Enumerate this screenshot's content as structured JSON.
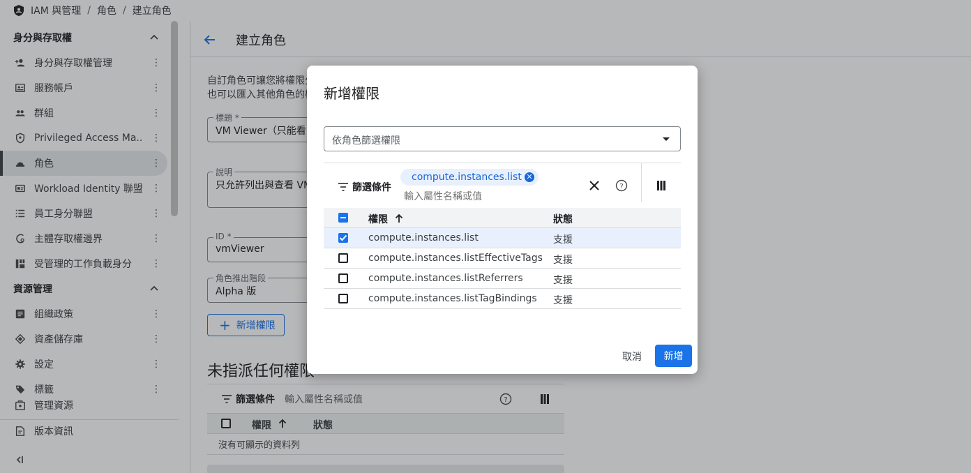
{
  "breadcrumb": [
    "IAM 與管理",
    "角色",
    "建立角色"
  ],
  "sidebar": {
    "sections": [
      {
        "label": "身分與存取權",
        "items": [
          {
            "label": "身分與存取權管理",
            "icon": "person-add-icon"
          },
          {
            "label": "服務帳戶",
            "icon": "service-account-icon"
          },
          {
            "label": "群組",
            "icon": "group-icon"
          },
          {
            "label": "Privileged Access Ma...",
            "icon": "shield-icon"
          },
          {
            "label": "角色",
            "icon": "hat-icon",
            "active": true
          },
          {
            "label": "Workload Identity 聯盟",
            "icon": "id-card-icon"
          },
          {
            "label": "員工身分聯盟",
            "icon": "list-icon"
          },
          {
            "label": "主體存取權邊界",
            "icon": "boundary-icon"
          },
          {
            "label": "受管理的工作負載身分",
            "icon": "grid-icon"
          }
        ]
      },
      {
        "label": "資源管理",
        "items": [
          {
            "label": "組織政策",
            "icon": "policy-icon"
          },
          {
            "label": "資產儲存庫",
            "icon": "asset-icon"
          },
          {
            "label": "設定",
            "icon": "gear-icon"
          },
          {
            "label": "標籤",
            "icon": "tag-icon"
          }
        ]
      }
    ],
    "extra_items": [
      {
        "label": "管理資源",
        "icon": "manage-resources-icon"
      },
      {
        "label": "版本資訊",
        "icon": "release-notes-icon"
      }
    ]
  },
  "main": {
    "title": "建立角色",
    "intro_line1": "自訂角色可讓您將權限分",
    "intro_line2": "也可以匯入其他角色的權",
    "fields": [
      {
        "label": "標題 *",
        "value": "VM Viewer（只能看 V"
      },
      {
        "label": "說明",
        "value": "只允許列出與查看 VM"
      },
      {
        "label": "ID *",
        "value": "vmViewer"
      },
      {
        "label": "角色推出階段",
        "value": "Alpha 版"
      }
    ],
    "add_permissions_label": "新增權限",
    "unassigned_title": "未指派任何權限",
    "filter_label": "篩選條件",
    "filter_placeholder": "輸入屬性名稱或值",
    "col_permission": "權限",
    "col_status": "狀態",
    "empty_text": "沒有可顯示的資料列"
  },
  "dialog": {
    "title": "新增權限",
    "role_filter_placeholder": "依角色篩選權限",
    "filter_label": "篩選條件",
    "filter_chip": "compute.instances.list",
    "filter_input_placeholder": "輸入屬性名稱或值",
    "col_permission": "權限",
    "col_status": "狀態",
    "rows": [
      {
        "permission": "compute.instances.list",
        "status": "支援",
        "checked": true
      },
      {
        "permission": "compute.instances.listEffectiveTags",
        "status": "支援",
        "checked": false
      },
      {
        "permission": "compute.instances.listReferrers",
        "status": "支援",
        "checked": false
      },
      {
        "permission": "compute.instances.listTagBindings",
        "status": "支援",
        "checked": false
      }
    ],
    "cancel_label": "取消",
    "add_label": "新增"
  },
  "colors": {
    "primary": "#1a73e8",
    "chip_bg": "#e8f0fe",
    "selected_row": "#e8f0fe"
  }
}
